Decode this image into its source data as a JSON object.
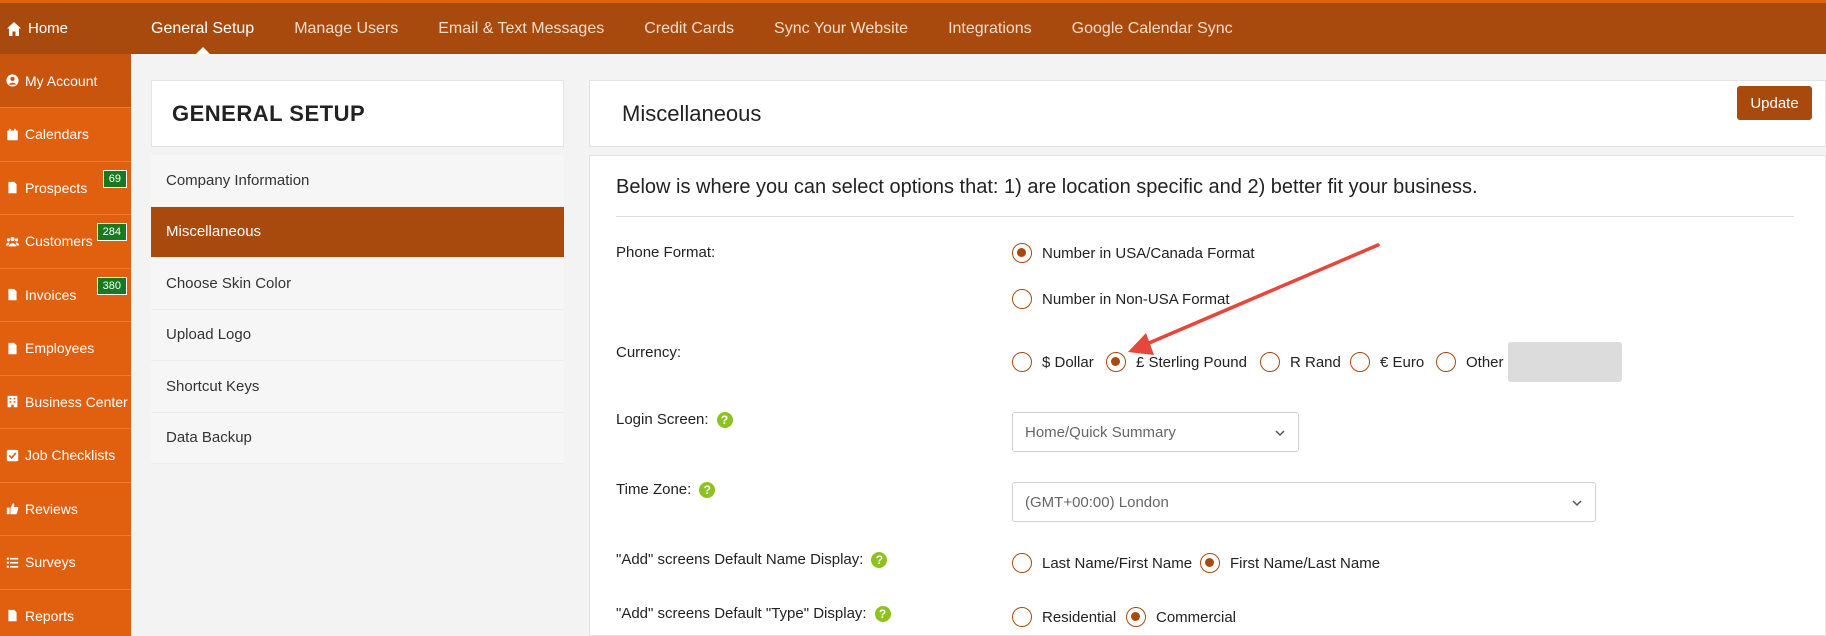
{
  "topnav": {
    "home_label": "Home",
    "tabs": [
      {
        "label": "General Setup",
        "active": true
      },
      {
        "label": "Manage Users"
      },
      {
        "label": "Email & Text Messages"
      },
      {
        "label": "Credit Cards"
      },
      {
        "label": "Sync Your Website"
      },
      {
        "label": "Integrations"
      },
      {
        "label": "Google Calendar Sync"
      }
    ]
  },
  "sidebar": {
    "items": [
      {
        "label": "My Account",
        "icon": "user-circle-icon"
      },
      {
        "label": "Calendars",
        "icon": "calendar-icon"
      },
      {
        "label": "Prospects",
        "icon": "file-icon",
        "badge": "69"
      },
      {
        "label": "Customers",
        "icon": "users-icon",
        "badge": "284"
      },
      {
        "label": "Invoices",
        "icon": "file-icon",
        "badge": "380"
      },
      {
        "label": "Employees",
        "icon": "file-icon"
      },
      {
        "label": "Business Center",
        "icon": "building-icon"
      },
      {
        "label": "Job Checklists",
        "icon": "checkbox-icon"
      },
      {
        "label": "Reviews",
        "icon": "thumbs-up-icon"
      },
      {
        "label": "Surveys",
        "icon": "list-icon"
      },
      {
        "label": "Reports",
        "icon": "file-icon"
      }
    ]
  },
  "general_setup": {
    "title": "GENERAL SETUP",
    "menu": [
      {
        "label": "Company Information"
      },
      {
        "label": "Miscellaneous",
        "active": true
      },
      {
        "label": "Choose Skin Color"
      },
      {
        "label": "Upload Logo"
      },
      {
        "label": "Shortcut Keys"
      },
      {
        "label": "Data Backup"
      }
    ]
  },
  "panel": {
    "title": "Miscellaneous",
    "update_label": "Update",
    "intro": "Below is where you can select options that: 1) are location specific and 2) better fit your business.",
    "phone": {
      "label": "Phone Format:",
      "options": [
        "Number in USA/Canada Format",
        "Number in Non-USA Format"
      ],
      "selected": 0
    },
    "currency": {
      "label": "Currency:",
      "options": [
        "$ Dollar",
        "£ Sterling Pound",
        "R Rand",
        "€ Euro",
        "Other"
      ],
      "selected": 1,
      "other_value": ""
    },
    "login": {
      "label": "Login Screen:",
      "value": "Home/Quick Summary"
    },
    "timezone": {
      "label": "Time Zone:",
      "value": "(GMT+00:00) London"
    },
    "name_display": {
      "label": "\"Add\" screens Default Name Display:",
      "options": [
        "Last Name/First Name",
        "First Name/Last Name"
      ],
      "selected": 1
    },
    "type_display": {
      "label": "\"Add\" screens Default \"Type\" Display:",
      "options": [
        "Residential",
        "Commercial"
      ],
      "selected": 1
    }
  },
  "colors": {
    "nav_bg": "#a84a0e",
    "sidebar_bg": "#e0600f",
    "accent": "#a84a0e",
    "badge": "#177a1e",
    "help": "#8dc21f",
    "annotation_arrow": "#e8453c"
  }
}
